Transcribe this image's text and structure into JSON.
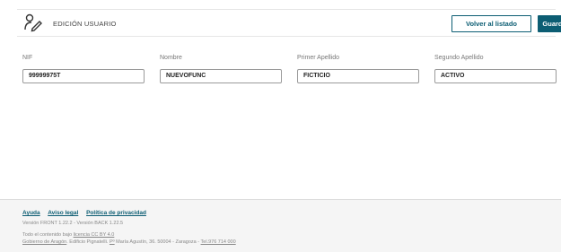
{
  "header": {
    "title": "EDICIÓN USUARIO",
    "back_label": "Volver al listado",
    "save_label": "Guardar"
  },
  "form": {
    "nif": {
      "label": "NIF",
      "value": "99999975T"
    },
    "nombre": {
      "label": "Nombre",
      "value": "NUEVOFUNC"
    },
    "primer_apellido": {
      "label": "Primer Apellido",
      "value": "FICTICIO"
    },
    "segundo_apellido": {
      "label": "Segundo Apellido",
      "value": "ACTIVO"
    }
  },
  "footer": {
    "links": [
      "Ayuda",
      "Aviso legal",
      "Política de privacidad"
    ],
    "version": "Versión FRONT 1.22.2 - Versión BACK 1.22.5",
    "license_prefix": "Todo el contenido bajo ",
    "license_link": "licencia CC BY 4.0",
    "address_org": "Gobierno de Aragón",
    "address_mid": ". Edificio Pignatelli. ",
    "address_plaza": "Pº",
    "address_rest": " María Agustín, 36. 50004 - Zaragoza - ",
    "address_tel": "Tel.976 714 000"
  },
  "colors": {
    "accent": "#0c5d73"
  }
}
